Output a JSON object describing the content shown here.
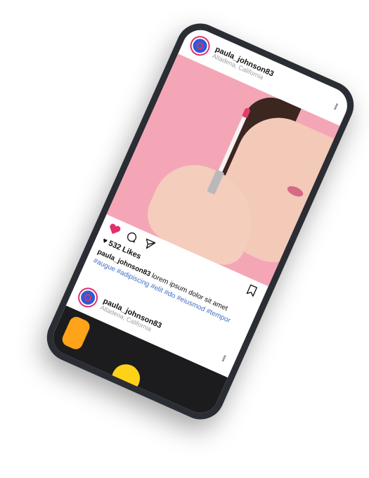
{
  "post1": {
    "username": "paula_johnson83",
    "location": "Altadena, California",
    "likes": "532 Likes",
    "caption_user": "paula_johnson83",
    "caption_text": " lorem ipsum dolor sit amet ",
    "caption_tags": "#augue  #adipiscing #elit #do #eiusmod #tempor"
  },
  "post2": {
    "username": "paula_johnson83",
    "location": "Altadena, California"
  },
  "icons": {
    "more": "more-vertical-icon",
    "like": "heart-icon",
    "comment": "comment-icon",
    "share": "send-icon",
    "save": "bookmark-icon"
  },
  "colors": {
    "like": "#e1306c",
    "hashtag": "#3f6fc9",
    "phone": "#2a2d33",
    "photo_bg": "#f4a6b6"
  }
}
